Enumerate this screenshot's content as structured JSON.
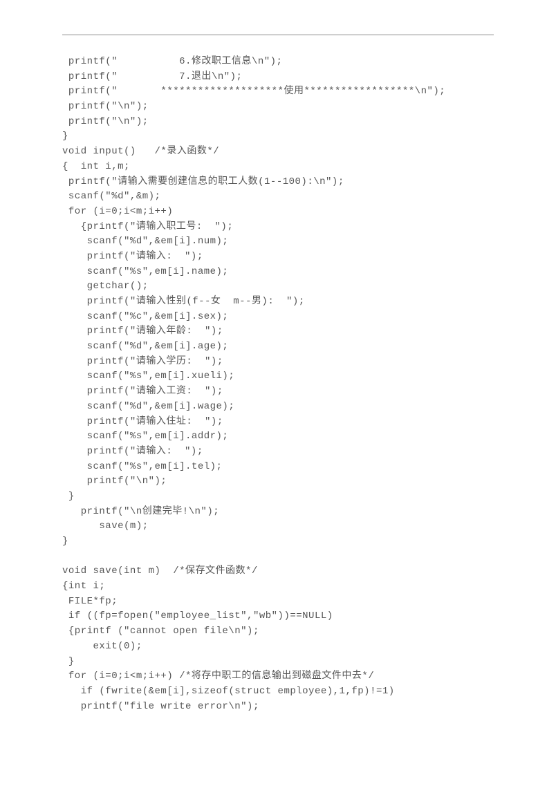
{
  "code_lines": [
    " printf(\"          6.修改职工信息\\n\");",
    " printf(\"          7.退出\\n\");",
    " printf(\"       ********************使用******************\\n\");",
    " printf(\"\\n\");",
    " printf(\"\\n\");",
    "}",
    "void input()   /*录入函数*/",
    "{  int i,m;",
    " printf(\"请输入需要创建信息的职工人数(1--100):\\n\");",
    " scanf(\"%d\",&m);",
    " for (i=0;i<m;i++)",
    "   {printf(\"请输入职工号:  \");",
    "    scanf(\"%d\",&em[i].num);",
    "    printf(\"请输入:  \");",
    "    scanf(\"%s\",em[i].name);",
    "    getchar();",
    "    printf(\"请输入性别(f--女  m--男):  \");",
    "    scanf(\"%c\",&em[i].sex);",
    "    printf(\"请输入年龄:  \");",
    "    scanf(\"%d\",&em[i].age);",
    "    printf(\"请输入学历:  \");",
    "    scanf(\"%s\",em[i].xueli);",
    "    printf(\"请输入工资:  \");",
    "    scanf(\"%d\",&em[i].wage);",
    "    printf(\"请输入住址:  \");",
    "    scanf(\"%s\",em[i].addr);",
    "    printf(\"请输入:  \");",
    "    scanf(\"%s\",em[i].tel);",
    "    printf(\"\\n\");",
    " }",
    "   printf(\"\\n创建完毕!\\n\");",
    "      save(m);",
    "}",
    "",
    "void save(int m)  /*保存文件函数*/",
    "{int i;",
    " FILE*fp;",
    " if ((fp=fopen(\"employee_list\",\"wb\"))==NULL)",
    " {printf (\"cannot open file\\n\");",
    "     exit(0);",
    " }",
    " for (i=0;i<m;i++) /*将存中职工的信息输出到磁盘文件中去*/",
    "   if (fwrite(&em[i],sizeof(struct employee),1,fp)!=1)",
    "   printf(\"file write error\\n\");"
  ]
}
